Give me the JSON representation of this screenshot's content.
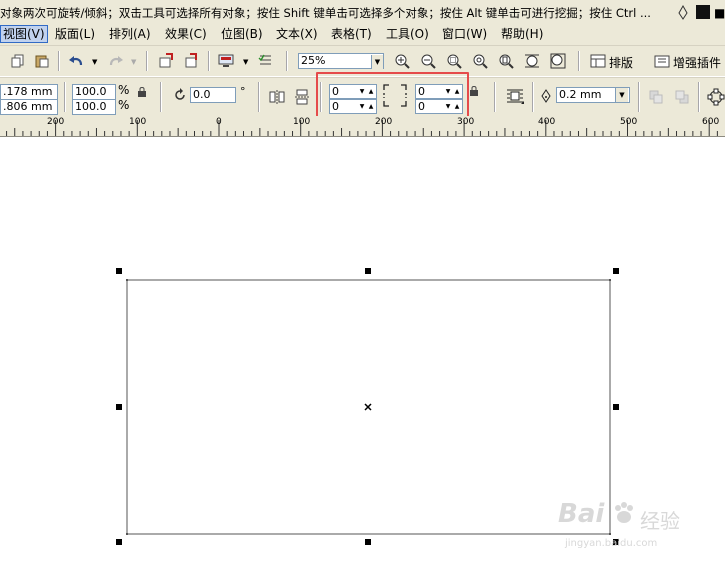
{
  "status": {
    "hint": "对象两次可旋转/倾斜；双击工具可选择所有对象；按住 Shift 键单击可选择多个对象；按住 Alt 键单击可进行挖掘；按住 Ctrl ..."
  },
  "menu": {
    "items": [
      "视图(V)",
      "版面(L)",
      "排列(A)",
      "效果(C)",
      "位图(B)",
      "文本(X)",
      "表格(T)",
      "工具(O)",
      "窗口(W)",
      "帮助(H)"
    ]
  },
  "toolbar1": {
    "zoom_value": "25%",
    "layout_label": "排版",
    "plugin_label": "增强插件"
  },
  "toolbar2": {
    "pos_x": ".178 mm",
    "pos_y": ".806 mm",
    "scale_x": "100.0",
    "scale_y": "100.0",
    "percent": "%",
    "rotation": "0.0",
    "degree": "°",
    "corner_tl": "0",
    "corner_bl": "0",
    "corner_tr": "0",
    "corner_br": "0",
    "outline_width": "0.2 mm"
  },
  "ruler": {
    "labels": [
      "200",
      "100",
      "0",
      "100",
      "200",
      "300",
      "400",
      "500",
      "600"
    ]
  },
  "watermark": {
    "brand": "Bai",
    "brand_cn": "经验",
    "url": "jingyan.baidu.com"
  },
  "colors": {
    "chrome": "#ece9d8",
    "highlight": "#e54b4b",
    "menu_active": "#c1d2ee"
  }
}
